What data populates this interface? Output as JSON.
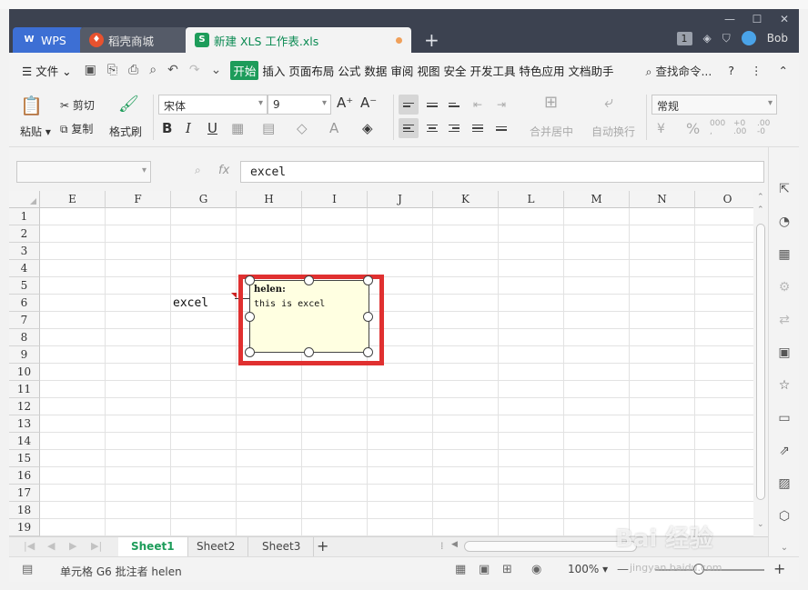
{
  "app": {
    "tabs": [
      {
        "label": "WPS"
      },
      {
        "label": "稻壳商城"
      },
      {
        "label": "新建 XLS 工作表.xls"
      }
    ],
    "badge": "1",
    "user": "Bob"
  },
  "menu": {
    "file": "文件",
    "items": [
      "开始",
      "插入",
      "页面布局",
      "公式",
      "数据",
      "审阅",
      "视图",
      "安全",
      "开发工具",
      "特色应用",
      "文档助手"
    ],
    "search": "查找命令...",
    "help": "?"
  },
  "ribbon": {
    "paste": "粘贴",
    "cut": "剪切",
    "copy": "复制",
    "format_painter": "格式刷",
    "font": "宋体",
    "size": "9",
    "merge": "合并居中",
    "wrap": "自动换行",
    "number_format": "常规",
    "bold": "B",
    "italic": "I",
    "underline": "U",
    "grow": "A⁺",
    "shrink": "A⁻"
  },
  "formula": {
    "fx": "fx",
    "value": "excel"
  },
  "grid": {
    "columns": [
      "E",
      "F",
      "G",
      "H",
      "I",
      "J",
      "K",
      "L",
      "M",
      "N",
      "O"
    ],
    "rows": [
      "1",
      "2",
      "3",
      "4",
      "5",
      "6",
      "7",
      "8",
      "9",
      "10",
      "11",
      "12",
      "13",
      "14",
      "15",
      "16",
      "17",
      "18",
      "19"
    ],
    "cell_G6": "excel"
  },
  "comment": {
    "author": "helen:",
    "text": "this is excel"
  },
  "sheets": [
    "Sheet1",
    "Sheet2",
    "Sheet3"
  ],
  "status": {
    "text": "单元格 G6 批注者 helen",
    "zoom": "100%"
  },
  "watermark": {
    "text": "Bai 经验",
    "url": "jingyan.baidu.com"
  }
}
